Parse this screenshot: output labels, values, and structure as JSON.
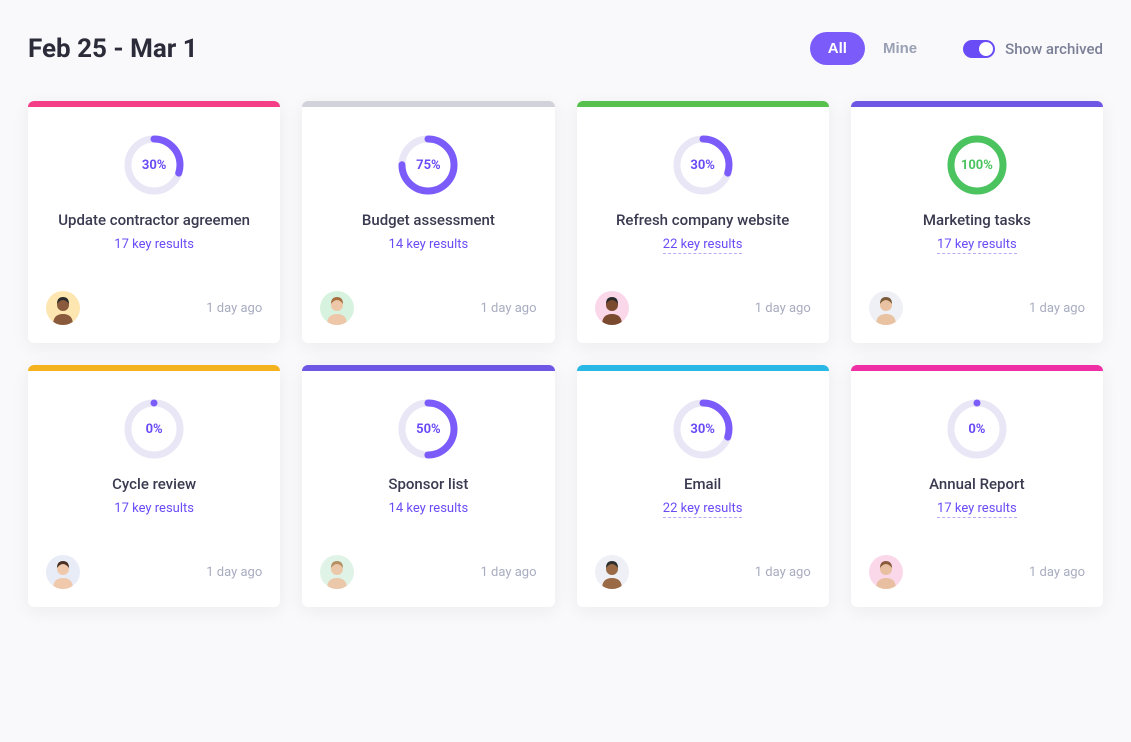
{
  "header": {
    "title": "Feb 25 - Mar 1",
    "filter_all_label": "All",
    "filter_mine_label": "Mine",
    "show_archived_label": "Show archived",
    "show_archived_on": true
  },
  "colors": {
    "purple": "#7b5cfa",
    "green": "#4bc35f",
    "ring_track": "#e9e6f6"
  },
  "cards": [
    {
      "stripe": "#f43f87",
      "percent": 30,
      "percent_label": "30%",
      "ring_color": "#7b5cfa",
      "title": "Update contractor agreemen",
      "key_results": "17 key results",
      "underline": false,
      "avatar_bg": "#fde6b0",
      "avatar_skin": "#8a5a3c",
      "avatar_hair": "#2b2b2b",
      "timestamp": "1 day ago"
    },
    {
      "stripe": "#d1d3da",
      "percent": 75,
      "percent_label": "75%",
      "ring_color": "#7b5cfa",
      "title": "Budget assessment",
      "key_results": "14 key results",
      "underline": false,
      "avatar_bg": "#d7f3df",
      "avatar_skin": "#eec6a8",
      "avatar_hair": "#a86f3f",
      "timestamp": "1 day ago"
    },
    {
      "stripe": "#56c24d",
      "percent": 30,
      "percent_label": "30%",
      "ring_color": "#7b5cfa",
      "title": "Refresh company website",
      "key_results": "22 key results",
      "underline": true,
      "avatar_bg": "#fbd7ea",
      "avatar_skin": "#7a4a2e",
      "avatar_hair": "#2b2b2b",
      "timestamp": "1 day ago"
    },
    {
      "stripe": "#6f57e6",
      "percent": 100,
      "percent_label": "100%",
      "ring_color": "#4bc35f",
      "title": "Marketing tasks",
      "key_results": "17 key results",
      "underline": true,
      "avatar_bg": "#eef0f5",
      "avatar_skin": "#e9c2a1",
      "avatar_hair": "#7a5a3a",
      "timestamp": "1 day ago"
    },
    {
      "stripe": "#f4b21e",
      "percent": 0,
      "percent_label": "0%",
      "ring_color": "#7b5cfa",
      "title": "Cycle review",
      "key_results": "17 key results",
      "underline": false,
      "avatar_bg": "#e7ecf6",
      "avatar_skin": "#f0c9ad",
      "avatar_hair": "#4a2f22",
      "timestamp": "1 day ago"
    },
    {
      "stripe": "#6f57e6",
      "percent": 50,
      "percent_label": "50%",
      "ring_color": "#7b5cfa",
      "title": "Sponsor list",
      "key_results": "14 key results",
      "underline": false,
      "avatar_bg": "#dff3e6",
      "avatar_skin": "#ecc8aa",
      "avatar_hair": "#b69064",
      "timestamp": "1 day ago"
    },
    {
      "stripe": "#29b7e6",
      "percent": 30,
      "percent_label": "30%",
      "ring_color": "#7b5cfa",
      "title": "Email",
      "key_results": "22 key results",
      "underline": true,
      "avatar_bg": "#eef0f5",
      "avatar_skin": "#9a6a47",
      "avatar_hair": "#2f2f2f",
      "timestamp": "1 day ago"
    },
    {
      "stripe": "#ef2fa4",
      "percent": 0,
      "percent_label": "0%",
      "ring_color": "#7b5cfa",
      "title": "Annual Report",
      "key_results": "17 key results",
      "underline": true,
      "avatar_bg": "#fbd7ea",
      "avatar_skin": "#e8bfa0",
      "avatar_hair": "#8a5a3c",
      "timestamp": "1 day ago"
    }
  ]
}
